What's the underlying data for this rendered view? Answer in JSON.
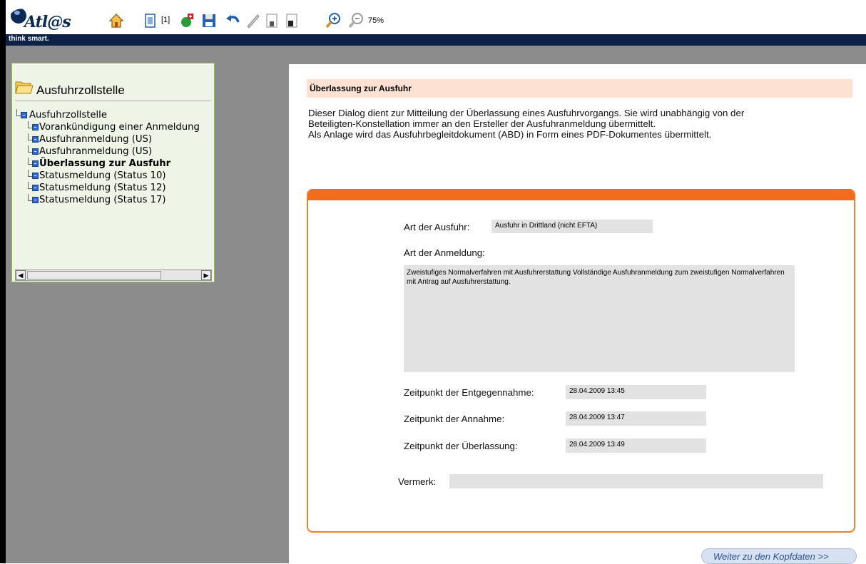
{
  "app": {
    "logo_text": "Atl@s",
    "tagline": "think smart.",
    "page_indicator": "[1]",
    "zoom": "75%"
  },
  "toolbar": {
    "icons": [
      "home-icon",
      "document-icon",
      "add-icon",
      "save-icon",
      "undo-icon",
      "pen-icon",
      "page-1-icon",
      "page-2-icon",
      "zoom-in-icon",
      "zoom-out-icon"
    ]
  },
  "tree": {
    "title": "Ausfuhrzollstelle",
    "items": [
      {
        "label": "Ausfuhrzollstelle",
        "root": true
      },
      {
        "label": "Vorankündigung einer Anmeldung"
      },
      {
        "label": "Ausfuhranmeldung  (US)"
      },
      {
        "label": "Ausfuhranmeldung  (US)"
      },
      {
        "label": "Überlassung zur Ausfuhr",
        "selected": true
      },
      {
        "label": "Statusmeldung (Status 10)"
      },
      {
        "label": "Statusmeldung (Status 12)"
      },
      {
        "label": "Statusmeldung (Status 17)"
      }
    ]
  },
  "main": {
    "section_title": "Überlassung zur  Ausfuhr",
    "description_line1": "Dieser Dialog dient zur Mitteilung der Überlassung eines Ausfuhrvorgangs. Sie wird unabhängig von der",
    "description_line2": "Beteiligten-Konstellation immer an den Ersteller der Ausfuhranmeldung übermittelt.",
    "description_line3": "Als Anlage wird das Ausfuhrbegleitdokument (ABD) in Form eines PDF-Dokumentes übermittelt.",
    "form": {
      "art_ausfuhr_label": "Art der Ausfuhr:",
      "art_ausfuhr_value": "Ausfuhr in Drittland (nicht EFTA)",
      "art_anmeldung_label": "Art der Anmeldung:",
      "art_anmeldung_value": "Zweistufiges Normalverfahren mit Ausfuhrerstattung  Vollständige Ausfuhranmeldung zum zweistufigen Normalverfahren mit Antrag auf Ausfuhrerstattung.",
      "entgegennahme_label": "Zeitpunkt der Entgegennahme:",
      "entgegennahme_value": "28.04.2009 13:45",
      "annahme_label": "Zeitpunkt der Annahme:",
      "annahme_value": "28.04.2009 13:47",
      "ueberlassung_label": "Zeitpunkt der Überlassung:",
      "ueberlassung_value": "28.04.2009 13:49",
      "vermerk_label": "Vermerk:",
      "vermerk_value": ""
    },
    "next_button": "Weiter zu den Kopfdaten  >>"
  },
  "colors": {
    "banner": "#0d2147",
    "accent": "#f36b1c",
    "header_bg": "#fde1d2",
    "tree_bg": "#eef5e6"
  }
}
